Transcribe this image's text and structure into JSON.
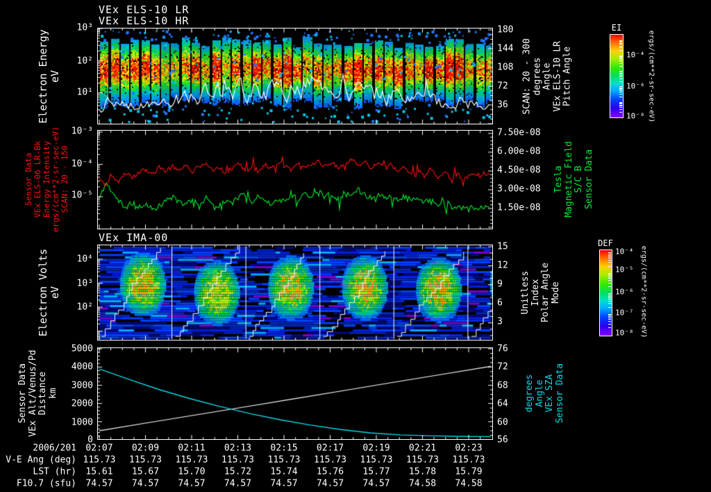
{
  "colors": {
    "axis": "#ffffff",
    "red": "#ff1111",
    "green": "#00ee33",
    "cyan": "#00dde8",
    "blue_speckle": "#2277ff",
    "cyan_speckle": "#00c8ee"
  },
  "titles": {
    "els_lr": "VEx ELS-10 LR",
    "els_hr": "VEx ELS-10 HR",
    "ima": "VEx IMA-00"
  },
  "panels": [
    {
      "id": "els",
      "left_label_lines": [
        "Electron Energy",
        "eV"
      ],
      "left_ticks": [
        "10³",
        "10²",
        "10¹"
      ],
      "right_ticks": [
        "180",
        "144",
        "108",
        "72",
        "36"
      ],
      "right_label_lines": [
        "SCAN: 20 - 300",
        "degrees",
        "Angle",
        "VEx ELS-10 LR",
        "Pitch Angle"
      ]
    },
    {
      "id": "intensity-bfield",
      "left_label_lines": [
        "Sensor Data",
        "VEx ELS-06 LR-Bk",
        "Energy Intensity",
        "ergs/(cm**2-sr-sec-eV)",
        "SCAN: 20 - 150"
      ],
      "left_ticks": [
        "10⁻³",
        "10⁻⁴",
        "10⁻⁵"
      ],
      "right_ticks": [
        "7.50e-08",
        "6.00e-08",
        "4.50e-08",
        "3.00e-08",
        "1.50e-08"
      ],
      "right_label_lines": [
        "Tesla",
        "Magnetic Field",
        "S/C B",
        "Sensor Data"
      ]
    },
    {
      "id": "ima",
      "left_label_lines": [
        "Electron Volts",
        "eV"
      ],
      "left_ticks": [
        "10⁴",
        "10³",
        "10²"
      ],
      "right_ticks": [
        "15",
        "12",
        "9",
        "6",
        "3"
      ],
      "right_label_lines": [
        "Unitless",
        "Index",
        "Polar Angle",
        "Mode"
      ]
    },
    {
      "id": "trajectory",
      "left_label_lines": [
        "Sensor Data",
        "VEx Alt/Venus/Pd",
        "Distance",
        "km"
      ],
      "left_ticks": [
        "5000",
        "4000",
        "3000",
        "2000",
        "1000",
        "0"
      ],
      "right_ticks": [
        "76",
        "72",
        "68",
        "64",
        "60",
        "56"
      ],
      "right_label_lines": [
        "degrees",
        "Angle",
        "VEx SZA",
        "Sensor Data"
      ]
    }
  ],
  "colorbars": [
    {
      "title": "EI",
      "units": "ergs/(cm**2-sr-sec-eV)",
      "ticks": [
        "10⁻⁴",
        "10⁻⁶",
        "10⁻⁸"
      ]
    },
    {
      "title": "DEF",
      "units": "ergs/(cm**2-sr-sec-eV)",
      "ticks": [
        "10⁻⁴",
        "10⁻⁵",
        "10⁻⁶",
        "10⁻⁷",
        "10⁻⁸"
      ]
    }
  ],
  "time_axis": {
    "date_label": "2006/201",
    "ticks": [
      "02:07",
      "02:09",
      "02:11",
      "02:13",
      "02:15",
      "02:17",
      "02:19",
      "02:21",
      "02:23"
    ]
  },
  "table": {
    "rows": [
      {
        "label": "V-E Ang (deg)",
        "values": [
          "115.73",
          "115.73",
          "115.73",
          "115.73",
          "115.73",
          "115.73",
          "115.73",
          "115.73",
          "115.73"
        ]
      },
      {
        "label": "LST (hr)",
        "values": [
          "15.61",
          "15.67",
          "15.70",
          "15.72",
          "15.74",
          "15.76",
          "15.77",
          "15.78",
          "15.79"
        ]
      },
      {
        "label": "F10.7 (sfu)",
        "values": [
          "74.57",
          "74.57",
          "74.57",
          "74.57",
          "74.57",
          "74.57",
          "74.57",
          "74.58",
          "74.58"
        ]
      }
    ]
  },
  "chart_data": [
    {
      "type": "heatmap",
      "title": "VEx ELS-10 LR / VEx ELS-10 HR",
      "ylabel": "Electron Energy (eV)",
      "y_scale": "log",
      "ylim_log10_ev": [
        0,
        3
      ],
      "x_range": [
        "02:07",
        "02:24"
      ],
      "right_axis": {
        "label": "Pitch Angle VEx ELS-10 LR (degrees), SCAN: 20 - 300",
        "lim": [
          0,
          180
        ]
      },
      "colorbar": {
        "name": "EI",
        "units": "ergs/(cm**2-sr-sec-eV)",
        "clim_log10": [
          -8,
          -4
        ]
      },
      "visual": {
        "stripe_count": 39,
        "hot_band_log10_ev": [
          1.3,
          2.2
        ],
        "speckle_colors": [
          "#2277ff",
          "#00c8ee"
        ],
        "overlay": "white jagged trace near 1-10 eV, larger excursions mid-interval"
      }
    },
    {
      "type": "line",
      "left_lim_log10": [
        -6,
        -3
      ],
      "right_lim_e8": [
        0,
        7.7
      ],
      "series": [
        {
          "name": "VEx ELS-06 LR-Bk Energy Intensity",
          "axis": "left",
          "units": "ergs/(cm**2-sr-sec-eV)",
          "color": "#ff1111",
          "log10_values": [
            -4.52,
            -4.66,
            -4.4,
            -4.55,
            -4.3,
            -4.45,
            -4.28,
            -4.18,
            -4.33,
            -4.12,
            -4.24,
            -4.08,
            -4.2,
            -4.04,
            -4.24,
            -4.1,
            -3.96,
            -4.2,
            -4.08,
            -4.28,
            -4.14,
            -4.0,
            -4.18,
            -4.08,
            -4.24,
            -4.04,
            -4.14,
            -3.96,
            -4.1,
            -4.2,
            -4.0,
            -4.14,
            -4.04,
            -3.92,
            -4.1,
            -3.96,
            -4.14,
            -4.0,
            -3.88,
            -4.04,
            -3.92,
            -4.1,
            -3.96,
            -4.18,
            -4.04,
            -4.28,
            -4.1,
            -4.34,
            -4.18,
            -4.4,
            -4.14,
            -4.44,
            -4.24,
            -4.48,
            -4.3,
            -4.52,
            -4.34,
            -4.44,
            -4.3,
            -4.38
          ]
        },
        {
          "name": "S/C B Magnetic Field",
          "axis": "right",
          "units": "Tesla",
          "color": "#00ee33",
          "values_e8": [
            2.3,
            3.6,
            2.8,
            2.0,
            1.6,
            1.85,
            1.5,
            1.95,
            1.45,
            1.7,
            2.05,
            2.4,
            2.1,
            1.8,
            2.3,
            1.6,
            2.5,
            2.0,
            1.7,
            2.2,
            1.9,
            2.45,
            2.6,
            2.1,
            2.5,
            2.2,
            1.8,
            2.3,
            2.0,
            2.6,
            2.25,
            2.8,
            2.4,
            2.9,
            2.5,
            2.7,
            2.3,
            2.8,
            2.55,
            3.0,
            2.6,
            2.4,
            2.7,
            2.35,
            2.6,
            2.2,
            2.5,
            2.1,
            2.4,
            2.0,
            2.2,
            1.85,
            2.1,
            1.75,
            1.65,
            1.6,
            1.65,
            1.55,
            1.6,
            1.62
          ]
        }
      ]
    },
    {
      "type": "heatmap",
      "title": "VEx IMA-00",
      "ylabel": "Electron Volts (eV)",
      "y_scale": "log",
      "right_axis": {
        "label": "Mode / Polar Angle Index (Unitless)",
        "lim": [
          0,
          15
        ]
      },
      "colorbar": {
        "name": "DEF",
        "units": "ergs/(cm**2-sr-sec-eV)",
        "clim_log10": [
          -8,
          -4
        ]
      },
      "visual": {
        "cell_count": 6,
        "cells": "blue striped background, green-yellow blob per cell, white staircase per cell"
      }
    },
    {
      "type": "line",
      "left_lim_km": [
        0,
        5000
      ],
      "right_lim_deg": [
        56,
        76
      ],
      "series": [
        {
          "name": "VEx Alt/Venus/Pd Distance",
          "axis": "left",
          "units": "km",
          "color": "#ffffff",
          "values": [
            400,
            855,
            1310,
            1765,
            2220,
            2680,
            3140,
            3595,
            4050
          ]
        },
        {
          "name": "VEx SZA Angle",
          "axis": "right",
          "units": "degrees",
          "color": "#00dde8",
          "values": [
            71.6,
            69.2,
            66.9,
            64.9,
            63.1,
            61.5,
            60.1,
            58.9,
            57.9,
            57.1,
            56.65,
            56.45,
            56.32,
            56.25
          ]
        }
      ]
    }
  ]
}
